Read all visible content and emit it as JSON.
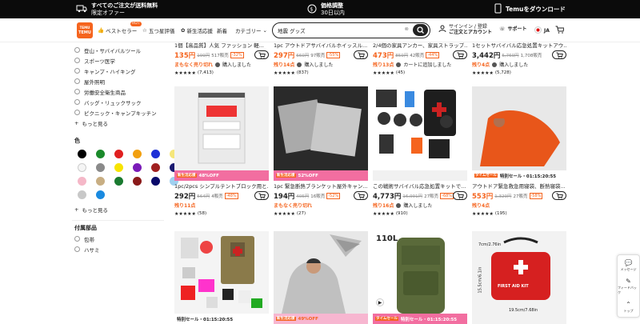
{
  "topbar": {
    "shipping_line1": "すべてのご注文が送料無料",
    "shipping_line2": "限定オファー",
    "price_line1": "価格調整",
    "price_line2": "30日以内",
    "download": "Temuをダウンロード"
  },
  "nav": {
    "logo_top": "TEMU",
    "logo_bottom": "TEMU",
    "bestseller": "ベストセラー",
    "hot_badge": "HOT",
    "five_star": "五つ星評価",
    "new_arrivals": "新生活応援",
    "new": "新着",
    "category": "カテゴリー",
    "search_value": "地震 グッズ",
    "signin_line1": "サインイン / 登録",
    "signin_line2": "ご注文とアカウント",
    "support": "サポート",
    "lang": "JA"
  },
  "sidebar": {
    "items": [
      "登山・サバイバルツール",
      "スポーツ医学",
      "キャンプ・ハイキング",
      "屋外照明",
      "労働安全衛生商品",
      "バッグ・リュックサック",
      "ピクニック・キャンプキッチン"
    ],
    "more1": "もっと見る",
    "color_heading": "色",
    "colors": [
      "#000000",
      "#1b8a2b",
      "#e02020",
      "#f2a010",
      "#1d2fd6",
      "#f5e67a",
      "#f5f5f5",
      "#8a8a8a",
      "#f7e400",
      "#7a1bb8",
      "#a02020",
      "#1a1a70",
      "#f5b8c8",
      "#c8ae83",
      "#1a7a30",
      "#8a1a1a",
      "#0a0a6a",
      "#9fd0f0",
      "#c8c8c8",
      "#1a8ae0"
    ],
    "more2": "もっと見る",
    "accessory_heading": "付属部品",
    "acc1": "包帯",
    "acc2": "ハサミ"
  },
  "row1": [
    {
      "title": "1個【高品質】人気 ファッション 軽...",
      "price": "135円",
      "orig": "199円",
      "sold": "517販売",
      "disc": "-32%",
      "status": "まもなく売り切れ",
      "status2": "購入しました",
      "rating": "(7,413)"
    },
    {
      "title": "1pc アウトドアサバイバルホイッスル...",
      "price": "297円",
      "orig": "660円",
      "sold": "97販売",
      "disc": "-55%",
      "status": "残り14点",
      "status2": "購入しました",
      "rating": "(837)"
    },
    {
      "title": "2/4個の家具アンカー、家具ストラップ...",
      "price": "473円",
      "orig": "859円",
      "sold": "42販売",
      "disc": "-44%",
      "status": "残り13点",
      "status2": "カートに追加しました",
      "rating": "(45)"
    },
    {
      "title": "1セットサバイバル応急処置キットアウ...",
      "price": "3,442円",
      "orig": "5,769円",
      "sold": "1,708販売",
      "disc": "",
      "status": "残り4点",
      "status2": "購入しました",
      "rating": "(5,728)"
    }
  ],
  "row2": [
    {
      "title": "1pc/2pcs シンプルテントブロック用と...",
      "price": "292円",
      "orig": "564円",
      "sold": "4販売",
      "disc": "-48%",
      "status": "残り11点",
      "status2": "",
      "rating": "(58)",
      "promo": "48%OFF",
      "promo_tag": "新生活応援"
    },
    {
      "title": "1pc 緊急断熱ブランケット屋外キャン...",
      "price": "194円",
      "orig": "405円",
      "sold": "16販売",
      "disc": "-52%",
      "status": "まもなく売り切れ",
      "status2": "",
      "rating": "(27)",
      "promo": "52%OFF",
      "promo_tag": "新生活応援"
    },
    {
      "title": "この戦術サバイバル応急処置キットで...",
      "price": "4,773円",
      "orig": "16,991円",
      "sold": "27販売",
      "disc": "-68%",
      "status": "残り16点",
      "status2": "購入しました",
      "rating": "(910)",
      "promo": "",
      "promo_tag": ""
    },
    {
      "title": "アウトドア緊急救急用寝袋、断熱寝袋...",
      "price": "553円",
      "orig": "1,329円",
      "sold": "27販売",
      "disc": "-58%",
      "status": "残り4点",
      "status2": "",
      "rating": "(195)",
      "promo": "特別セール・01:15:20:55",
      "promo_tag": "タイムセール"
    }
  ],
  "row3": [
    {
      "promo": "特別セール・01:15:20:55"
    },
    {
      "promo": "49%OFF",
      "promo_tag": "新生活応援"
    },
    {
      "promo": "特別セール・01:15:20:55",
      "promo_tag": "タイムセール",
      "label": "110L"
    },
    {
      "dim1": "7cm/2.76in",
      "dim2": "15.5cm/6.1in",
      "dim3": "19.5cm/7.68in",
      "kit_text": "FIRST AID KIT"
    }
  ],
  "float": {
    "message": "メッセージ",
    "feedback": "フィードバック",
    "top": "トップ"
  }
}
